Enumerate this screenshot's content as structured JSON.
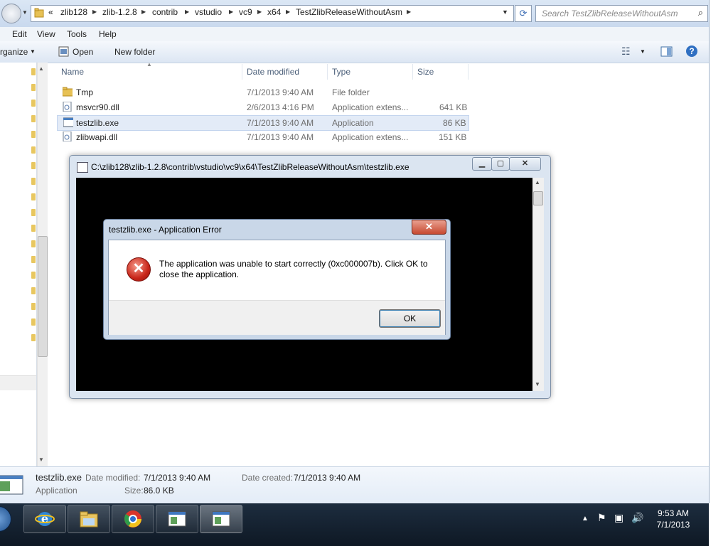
{
  "address": {
    "crumbs": [
      "zlib128",
      "zlib-1.2.8",
      "contrib",
      "vstudio",
      "vc9",
      "x64",
      "TestZlibReleaseWithoutAsm"
    ],
    "overflow": "«",
    "search_placeholder": "Search TestZlibReleaseWithoutAsm"
  },
  "menu": [
    "Edit",
    "View",
    "Tools",
    "Help"
  ],
  "toolbar": {
    "organize": "rganize",
    "open": "Open",
    "new_folder": "New folder"
  },
  "columns": {
    "name": "Name",
    "date": "Date modified",
    "type": "Type",
    "size": "Size"
  },
  "files": [
    {
      "name": "Tmp",
      "date": "7/1/2013 9:40 AM",
      "type": "File folder",
      "size": "",
      "icon": "folder-icon"
    },
    {
      "name": "msvcr90.dll",
      "date": "2/6/2013 4:16 PM",
      "type": "Application extens...",
      "size": "641 KB",
      "icon": "dll-icon"
    },
    {
      "name": "testzlib.exe",
      "date": "7/1/2013 9:40 AM",
      "type": "Application",
      "size": "86 KB",
      "icon": "exe-icon"
    },
    {
      "name": "zlibwapi.dll",
      "date": "7/1/2013 9:40 AM",
      "type": "Application extens...",
      "size": "151 KB",
      "icon": "dll-icon"
    }
  ],
  "details": {
    "name": "testzlib.exe",
    "modified_label": "Date modified:",
    "modified": "7/1/2013 9:40 AM",
    "created_label": "Date created:",
    "created": "7/1/2013 9:40 AM",
    "type": "Application",
    "size_label": "Size:",
    "size": "86.0 KB"
  },
  "console": {
    "title": "C:\\zlib128\\zlib-1.2.8\\contrib\\vstudio\\vc9\\x64\\TestZlibReleaseWithoutAsm\\testzlib.exe"
  },
  "error": {
    "title": "testzlib.exe - Application Error",
    "message": "The application was unable to start correctly (0xc000007b). Click OK to close the application.",
    "ok": "OK"
  },
  "taskbar": {
    "apps": [
      "internet-explorer-icon",
      "file-explorer-icon",
      "chrome-icon",
      "console-app-icon",
      "console-app-icon"
    ],
    "time": "9:53 AM",
    "date": "7/1/2013"
  },
  "colors": {
    "error_red": "#c8261a",
    "taskbar": "#142233",
    "selection": "#e3ebf7"
  }
}
